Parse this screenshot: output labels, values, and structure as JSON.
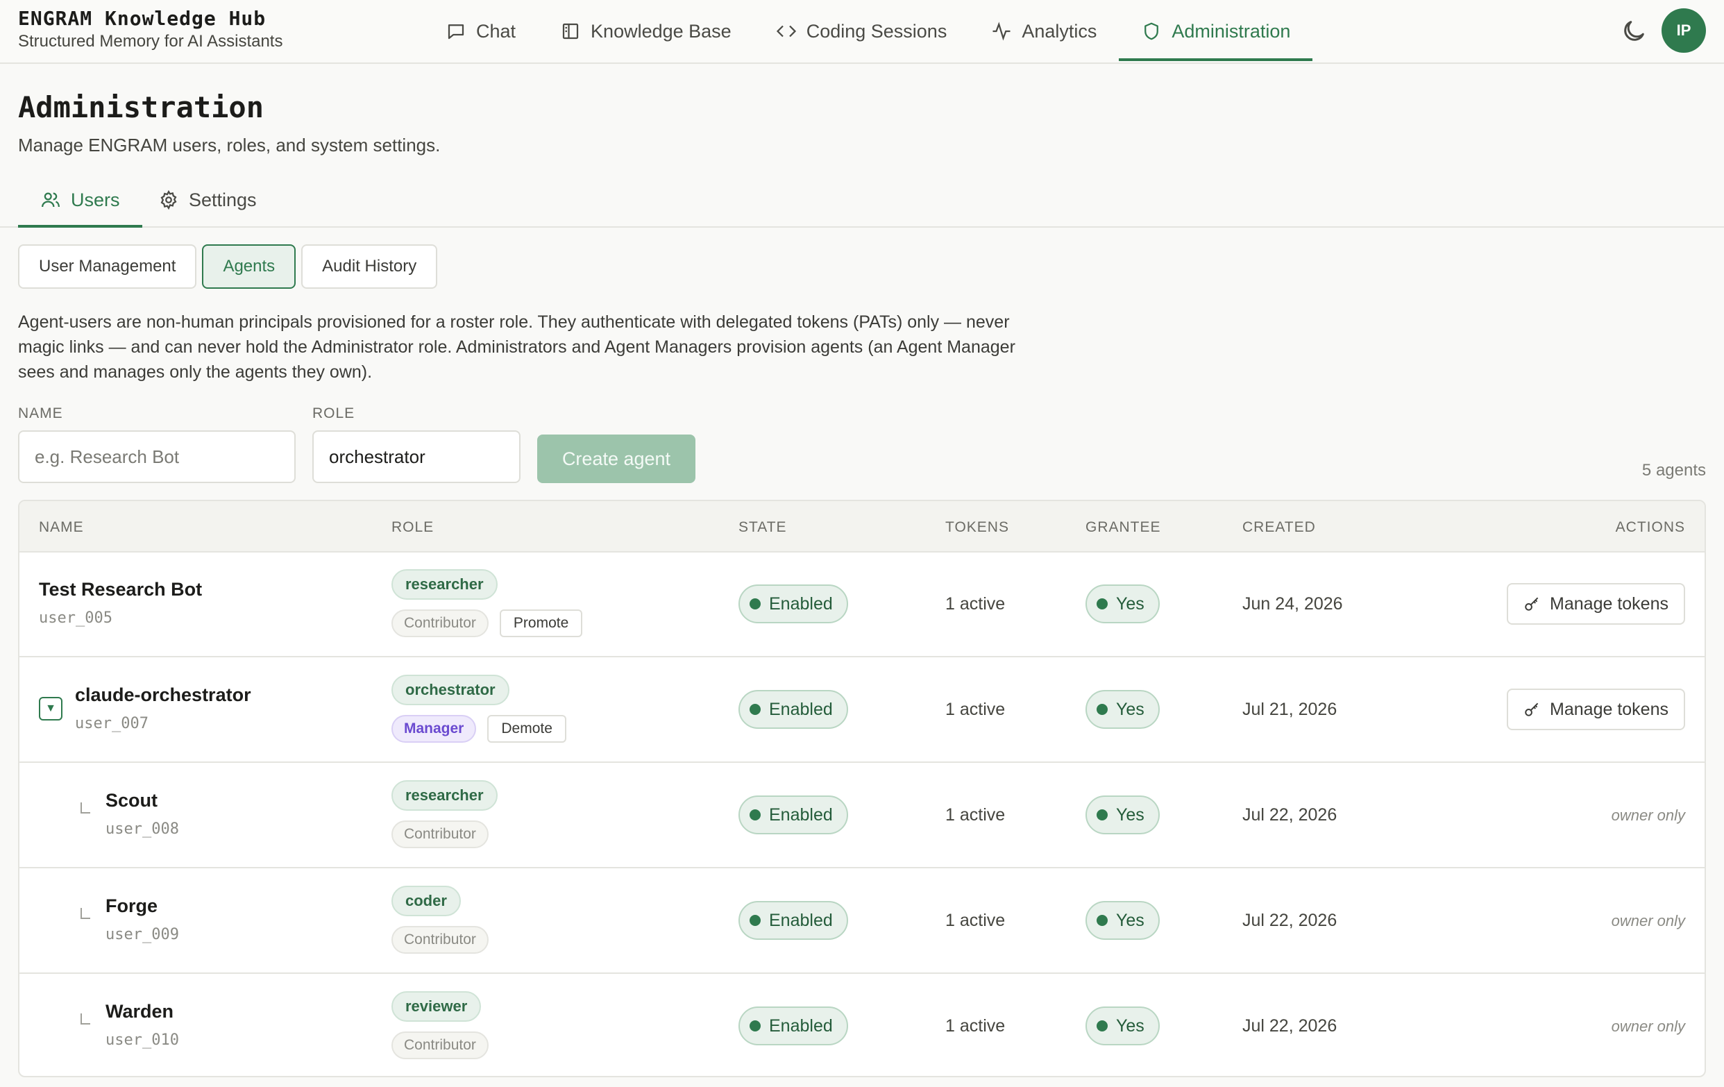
{
  "app": {
    "title": "ENGRAM Knowledge Hub",
    "subtitle": "Structured Memory for AI Assistants",
    "avatar_initials": "IP",
    "accent_color": "#2f7a4e"
  },
  "nav": [
    {
      "label": "Chat",
      "icon": "chat-bubble-icon"
    },
    {
      "label": "Knowledge Base",
      "icon": "book-icon"
    },
    {
      "label": "Coding Sessions",
      "icon": "code-brackets-icon"
    },
    {
      "label": "Analytics",
      "icon": "activity-icon"
    },
    {
      "label": "Administration",
      "icon": "shield-icon",
      "active": true
    }
  ],
  "page": {
    "title": "Administration",
    "description": "Manage ENGRAM users, roles, and system settings."
  },
  "tabs": [
    {
      "label": "Users",
      "icon": "users-icon",
      "active": true
    },
    {
      "label": "Settings",
      "icon": "gear-icon"
    }
  ],
  "subtabs": [
    {
      "label": "User Management"
    },
    {
      "label": "Agents",
      "active": true
    },
    {
      "label": "Audit History"
    }
  ],
  "intro": "Agent-users are non-human principals provisioned for a roster role. They authenticate with delegated tokens (PATs) only — never magic links — and can never hold the Administrator role. Administrators and Agent Managers provision agents (an Agent Manager sees and manages only the agents they own).",
  "form": {
    "name_label": "NAME",
    "name_placeholder": "e.g. Research Bot",
    "name_value": "",
    "role_label": "ROLE",
    "role_value": "orchestrator",
    "create_label": "Create agent",
    "count_label": "5 agents"
  },
  "table": {
    "headers": {
      "name": "NAME",
      "role": "ROLE",
      "state": "STATE",
      "tokens": "TOKENS",
      "grantee": "GRANTEE",
      "created": "CREATED",
      "actions": "ACTIONS"
    },
    "rows": [
      {
        "name": "Test Research Bot",
        "uid": "user_005",
        "role": "researcher",
        "tier": "Contributor",
        "tier_action": "Promote",
        "state": "Enabled",
        "tokens": "1 active",
        "grantee": "Yes",
        "created": "Jun 24, 2026",
        "action": "Manage tokens"
      },
      {
        "name": "claude-orchestrator",
        "uid": "user_007",
        "toggle": "▼",
        "role": "orchestrator",
        "tier": "Manager",
        "tier_action": "Demote",
        "state": "Enabled",
        "tokens": "1 active",
        "grantee": "Yes",
        "created": "Jul 21, 2026",
        "action": "Manage tokens"
      },
      {
        "name": "Scout",
        "uid": "user_008",
        "role": "researcher",
        "tier": "Contributor",
        "state": "Enabled",
        "tokens": "1 active",
        "grantee": "Yes",
        "created": "Jul 22, 2026",
        "action": "owner only"
      },
      {
        "name": "Forge",
        "uid": "user_009",
        "role": "coder",
        "tier": "Contributor",
        "state": "Enabled",
        "tokens": "1 active",
        "grantee": "Yes",
        "created": "Jul 22, 2026",
        "action": "owner only"
      },
      {
        "name": "Warden",
        "uid": "user_010",
        "role": "reviewer",
        "tier": "Contributor",
        "state": "Enabled",
        "tokens": "1 active",
        "grantee": "Yes",
        "created": "Jul 22, 2026",
        "action": "owner only"
      }
    ]
  }
}
